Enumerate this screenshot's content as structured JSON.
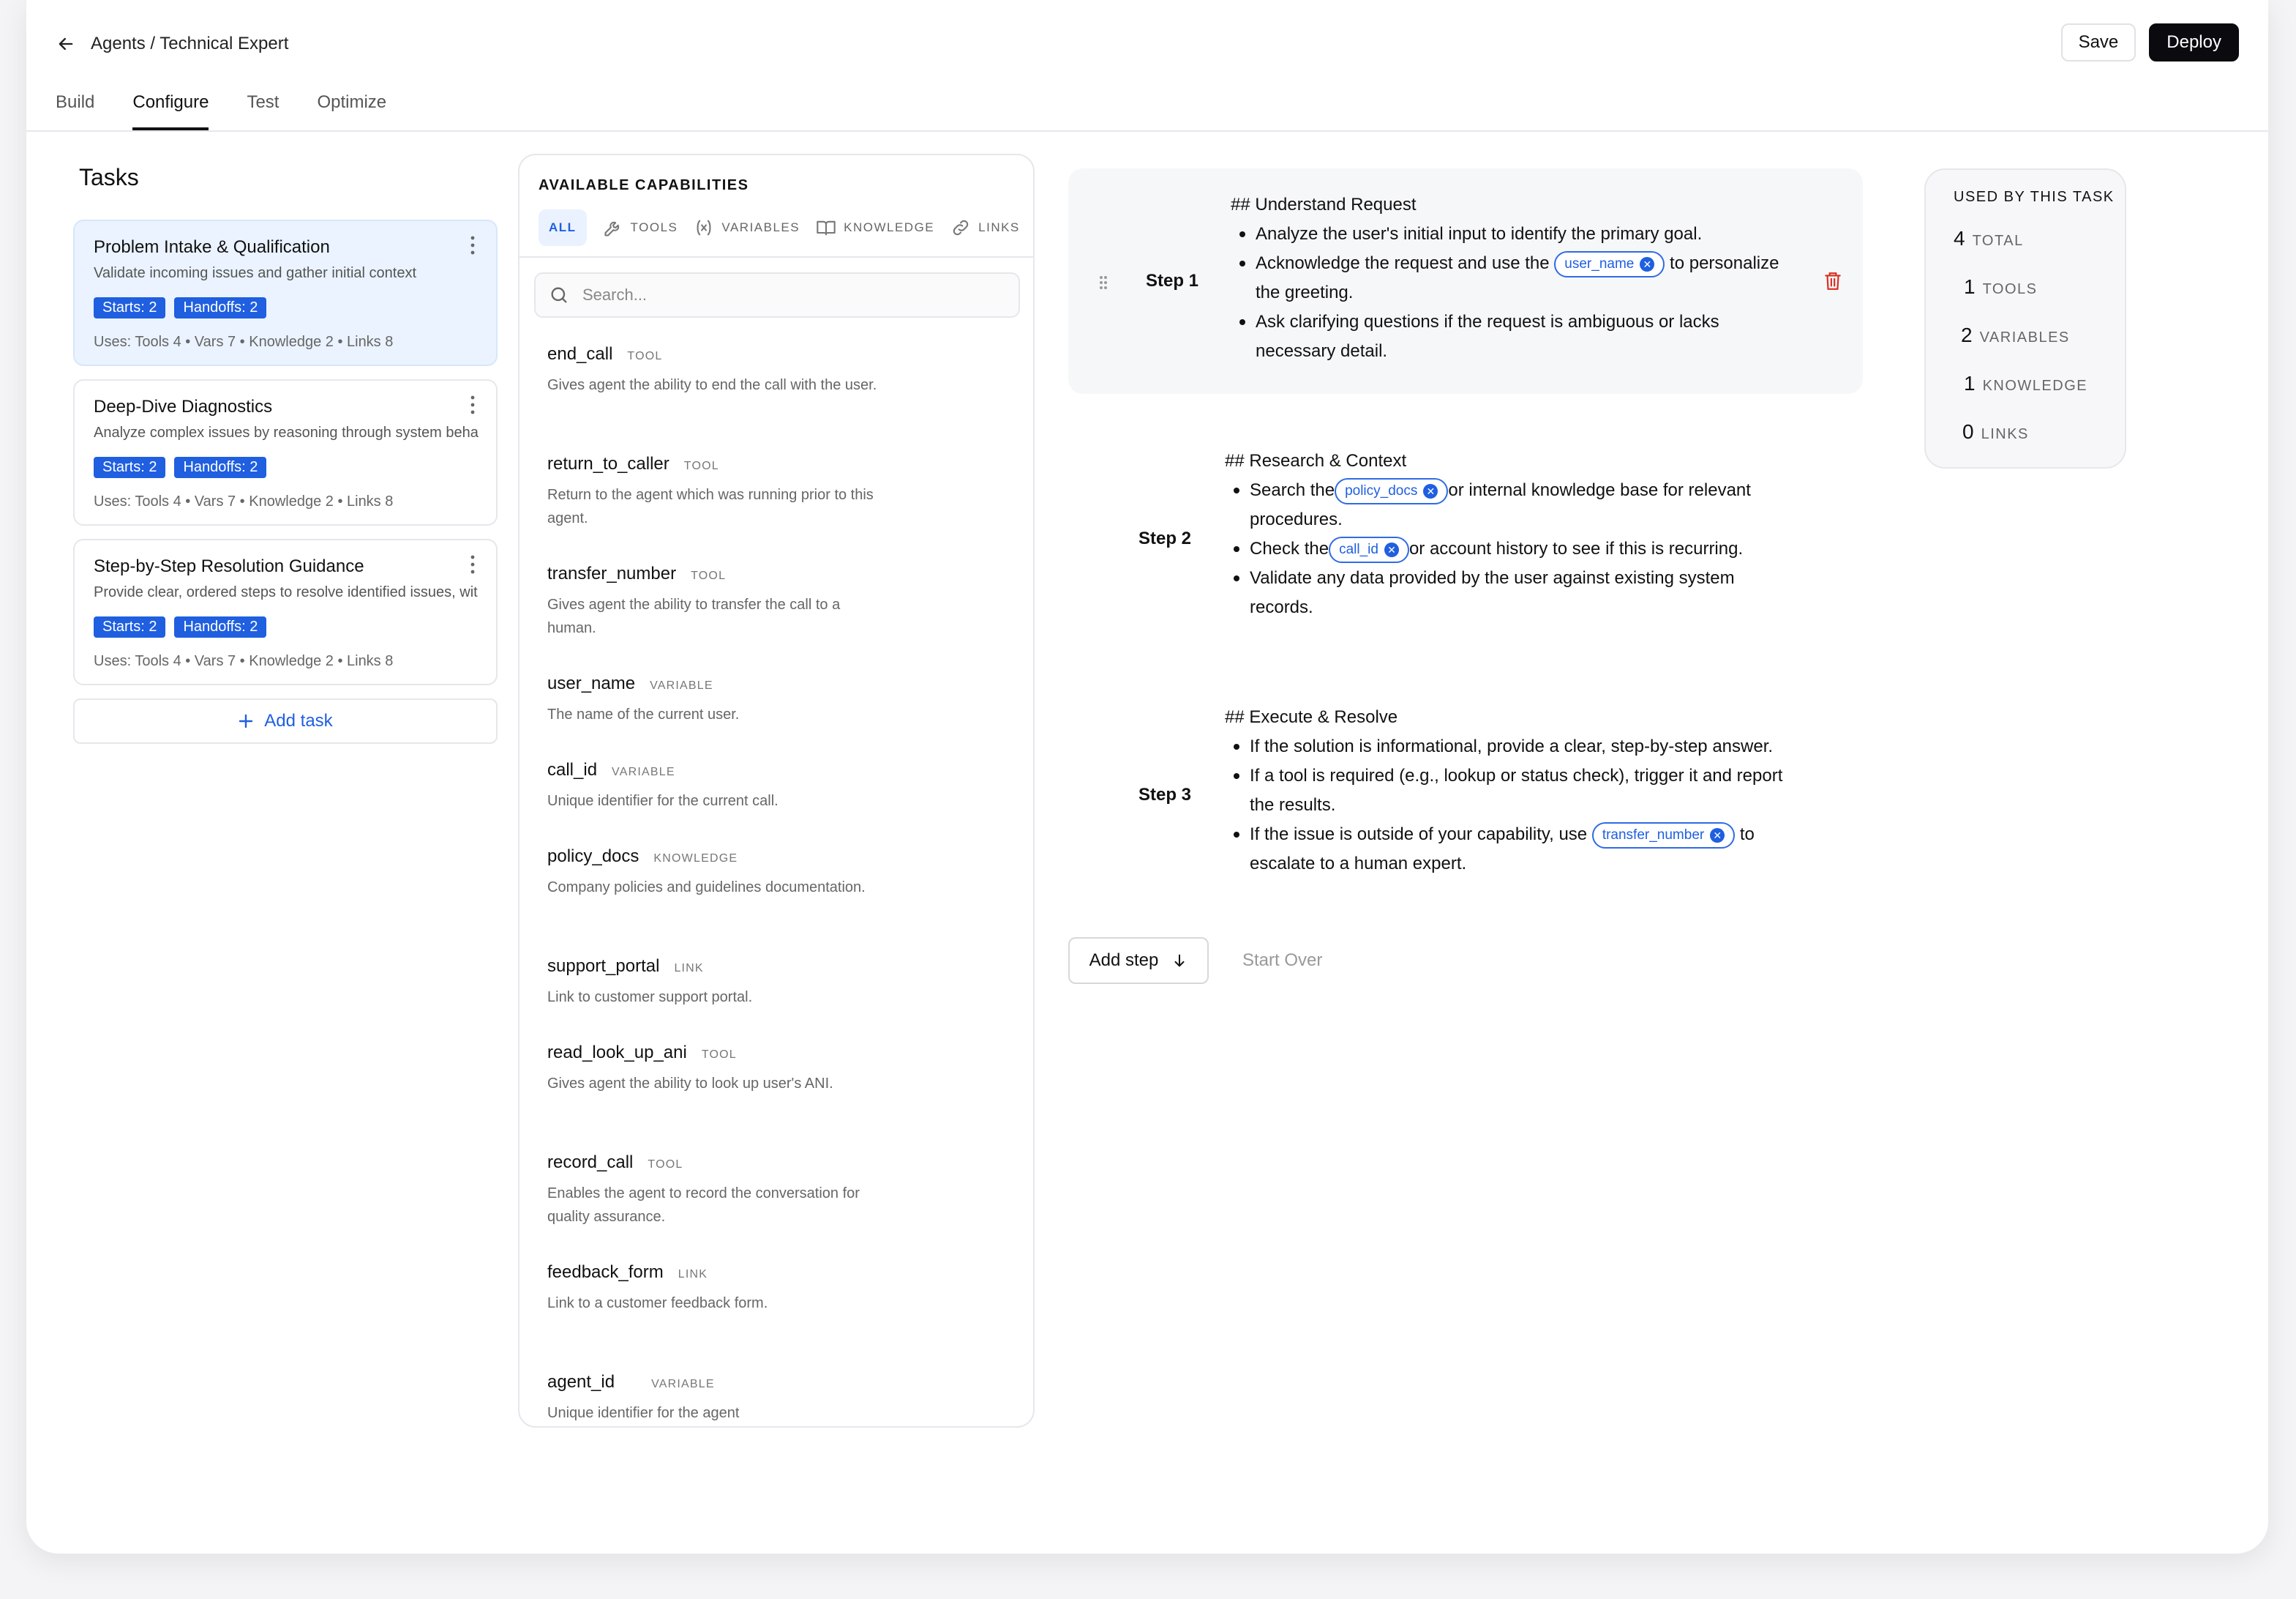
{
  "header": {
    "breadcrumb": "Agents / Technical Expert",
    "save_label": "Save",
    "deploy_label": "Deploy"
  },
  "tabs": [
    {
      "label": "Build"
    },
    {
      "label": "Configure"
    },
    {
      "label": "Test"
    },
    {
      "label": "Optimize"
    }
  ],
  "tasks": {
    "title": "Tasks",
    "items": [
      {
        "name": "Problem Intake & Qualification",
        "desc": "Validate incoming issues and gather initial context",
        "starts": "Starts: 2",
        "handoffs": "Handoffs: 2",
        "uses": "Uses: Tools 4 • Vars 7 • Knowledge 2 • Links 8"
      },
      {
        "name": "Deep-Dive Diagnostics",
        "desc": "Analyze complex issues by reasoning through system beha",
        "starts": "Starts: 2",
        "handoffs": "Handoffs: 2",
        "uses": "Uses: Tools 4 • Vars 7 • Knowledge 2 • Links 8"
      },
      {
        "name": "Step-by-Step Resolution Guidance",
        "desc": "Provide clear, ordered steps to resolve identified issues, wit",
        "starts": "Starts: 2",
        "handoffs": "Handoffs: 2",
        "uses": "Uses: Tools 4 • Vars 7 • Knowledge 2 • Links 8"
      }
    ],
    "add_label": "Add task"
  },
  "capabilities": {
    "title": "AVAILABLE CAPABILITIES",
    "filters": [
      {
        "label": "ALL"
      },
      {
        "label": "TOOLS"
      },
      {
        "label": "VARIABLES"
      },
      {
        "label": "KNOWLEDGE"
      },
      {
        "label": "LINKS"
      }
    ],
    "search_placeholder": "Search...",
    "items": [
      {
        "name": "end_call",
        "type": "TOOL",
        "desc": "Gives agent the ability to end the call with the user."
      },
      {
        "name": "return_to_caller",
        "type": "TOOL",
        "desc": "Return to the agent which was running prior to this agent."
      },
      {
        "name": "transfer_number",
        "type": "TOOL",
        "desc": "Gives agent the ability to transfer the call to a human."
      },
      {
        "name": "user_name",
        "type": "VARIABLE",
        "desc": "The name of the current user."
      },
      {
        "name": "call_id",
        "type": "VARIABLE",
        "desc": "Unique identifier for the current call."
      },
      {
        "name": "policy_docs",
        "type": "KNOWLEDGE",
        "desc": "Company policies and guidelines documentation."
      },
      {
        "name": "support_portal",
        "type": "LINK",
        "desc": "Link to customer support portal."
      },
      {
        "name": "read_look_up_ani",
        "type": "TOOL",
        "desc": "Gives agent the ability to look up user's ANI."
      },
      {
        "name": "record_call",
        "type": "TOOL",
        "desc": "Enables the agent to record the conversation for quality assurance."
      },
      {
        "name": "feedback_form",
        "type": "LINK",
        "desc": "Link to a customer feedback form."
      },
      {
        "name": "agent_id",
        "type": "VARIABLE",
        "desc": "Unique identifier for the agent"
      }
    ]
  },
  "steps": [
    {
      "label": "Step 1",
      "heading": "## Understand Request",
      "b1": "Analyze the user's initial input to identify the primary goal.",
      "b2_pre": "Acknowledge the request and use the",
      "b2_chip": "user_name",
      "b2_post": "to personalize",
      "b2_cont": "the greeting.",
      "b3": "Ask clarifying questions if the request is ambiguous or lacks",
      "b3_cont": "necessary detail."
    },
    {
      "label": "Step 2",
      "heading": "## Research & Context",
      "b1_pre": "Search the",
      "b1_chip": "policy_docs",
      "b1_post": "or internal knowledge base for relevant",
      "b1_cont": "procedures.",
      "b2_pre": "Check the",
      "b2_chip": "call_id",
      "b2_post": "or account history to see if this is recurring.",
      "b3": "Validate any data provided by the user against existing system",
      "b3_cont": "records."
    },
    {
      "label": "Step 3",
      "heading": "## Execute & Resolve",
      "b1": "If the solution is informational, provide a clear, step-by-step answer.",
      "b2": "If a tool is required (e.g., lookup or status check), trigger it and report",
      "b2_cont": "the results.",
      "b3_pre": "If the issue is outside of your capability, use",
      "b3_chip": "transfer_number",
      "b3_post": "to",
      "b3_cont": "escalate to a human expert."
    }
  ],
  "step_actions": {
    "add_step": "Add step",
    "start_over": "Start Over"
  },
  "usage": {
    "title": "USED BY THIS TASK",
    "rows": [
      {
        "num": "4",
        "label": "TOTAL"
      },
      {
        "num": "1",
        "label": "TOOLS"
      },
      {
        "num": "2",
        "label": "VARIABLES"
      },
      {
        "num": "1",
        "label": "KNOWLEDGE"
      },
      {
        "num": "0",
        "label": "LINKS"
      }
    ]
  },
  "colors": {
    "accent": "#1f5fe0",
    "active_task_bg": "#eaf3ff",
    "delete": "#d92d20"
  }
}
